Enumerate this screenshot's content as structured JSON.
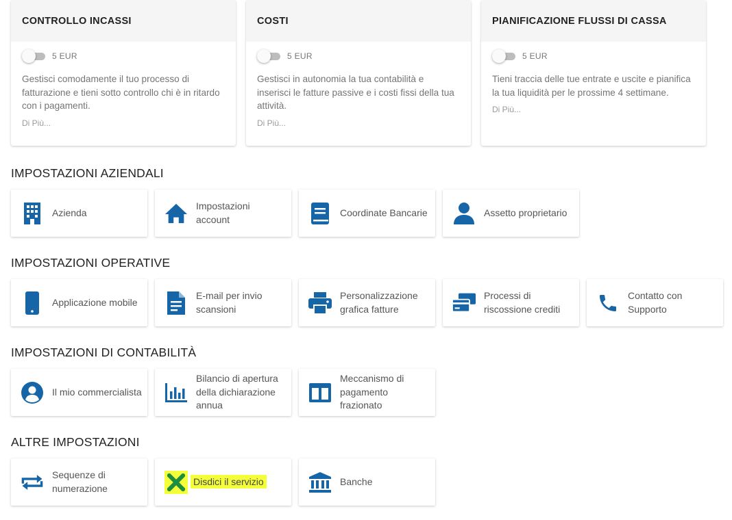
{
  "services": [
    {
      "title": "CONTROLLO INCASSI",
      "price": "5 EUR",
      "description": "Gestisci comodamente il tuo processo di fatturazione e tieni sotto controllo chi è in ritardo con i pagamenti.",
      "more": "Di Più..."
    },
    {
      "title": "COSTI",
      "price": "5 EUR",
      "description": "Gestisci in autonomia la tua contabilità e inserisci le fatture passive e i costi fissi della tua attività.",
      "more": "Di Più..."
    },
    {
      "title": "PIANIFICAZIONE FLUSSI DI CASSA",
      "price": "5 EUR",
      "description": "Tieni traccia delle tue entrate e uscite e pianifica la tua liquidità per le prossime 4 settimane.",
      "more": "Di Più..."
    }
  ],
  "sections": {
    "aziendali": {
      "title": "IMPOSTAZIONI AZIENDALI",
      "items": [
        {
          "label": "Azienda",
          "icon": "building-icon"
        },
        {
          "label": "Impostazioni account",
          "icon": "home-icon"
        },
        {
          "label": "Coordinate Bancarie",
          "icon": "book-icon"
        },
        {
          "label": "Assetto proprietario",
          "icon": "person-icon"
        }
      ]
    },
    "operative": {
      "title": "IMPOSTAZIONI OPERATIVE",
      "items": [
        {
          "label": "Applicazione mobile",
          "icon": "mobile-phone-icon"
        },
        {
          "label": "E-mail per invio scansioni",
          "icon": "document-icon"
        },
        {
          "label": "Personalizzazione grafica fatture",
          "icon": "printer-icon"
        },
        {
          "label": "Processi di riscossione crediti",
          "icon": "payment-icon"
        },
        {
          "label": "Contatto con Supporto",
          "icon": "phone-icon"
        }
      ]
    },
    "contabilita": {
      "title": "IMPOSTAZIONI DI CONTABILITÀ",
      "items": [
        {
          "label": "Il mio commercialista",
          "icon": "account-circle-icon"
        },
        {
          "label": "Bilancio di apertura della dichiarazione annua",
          "icon": "bar-chart-icon"
        },
        {
          "label": "Meccanismo di pagamento frazionato",
          "icon": "split-columns-icon"
        }
      ]
    },
    "altre": {
      "title": "ALTRE IMPOSTAZIONI",
      "items": [
        {
          "label": "Sequenze di numerazione",
          "icon": "repeat-arrows-icon"
        },
        {
          "label": "Disdici il servizio",
          "icon": "cancel-x-icon"
        },
        {
          "label": "Banche",
          "icon": "bank-icon"
        }
      ]
    }
  },
  "colors": {
    "icon": "#1565a7",
    "cancel_icon": "#1e8e3e",
    "highlight": "#f4ff3a"
  }
}
